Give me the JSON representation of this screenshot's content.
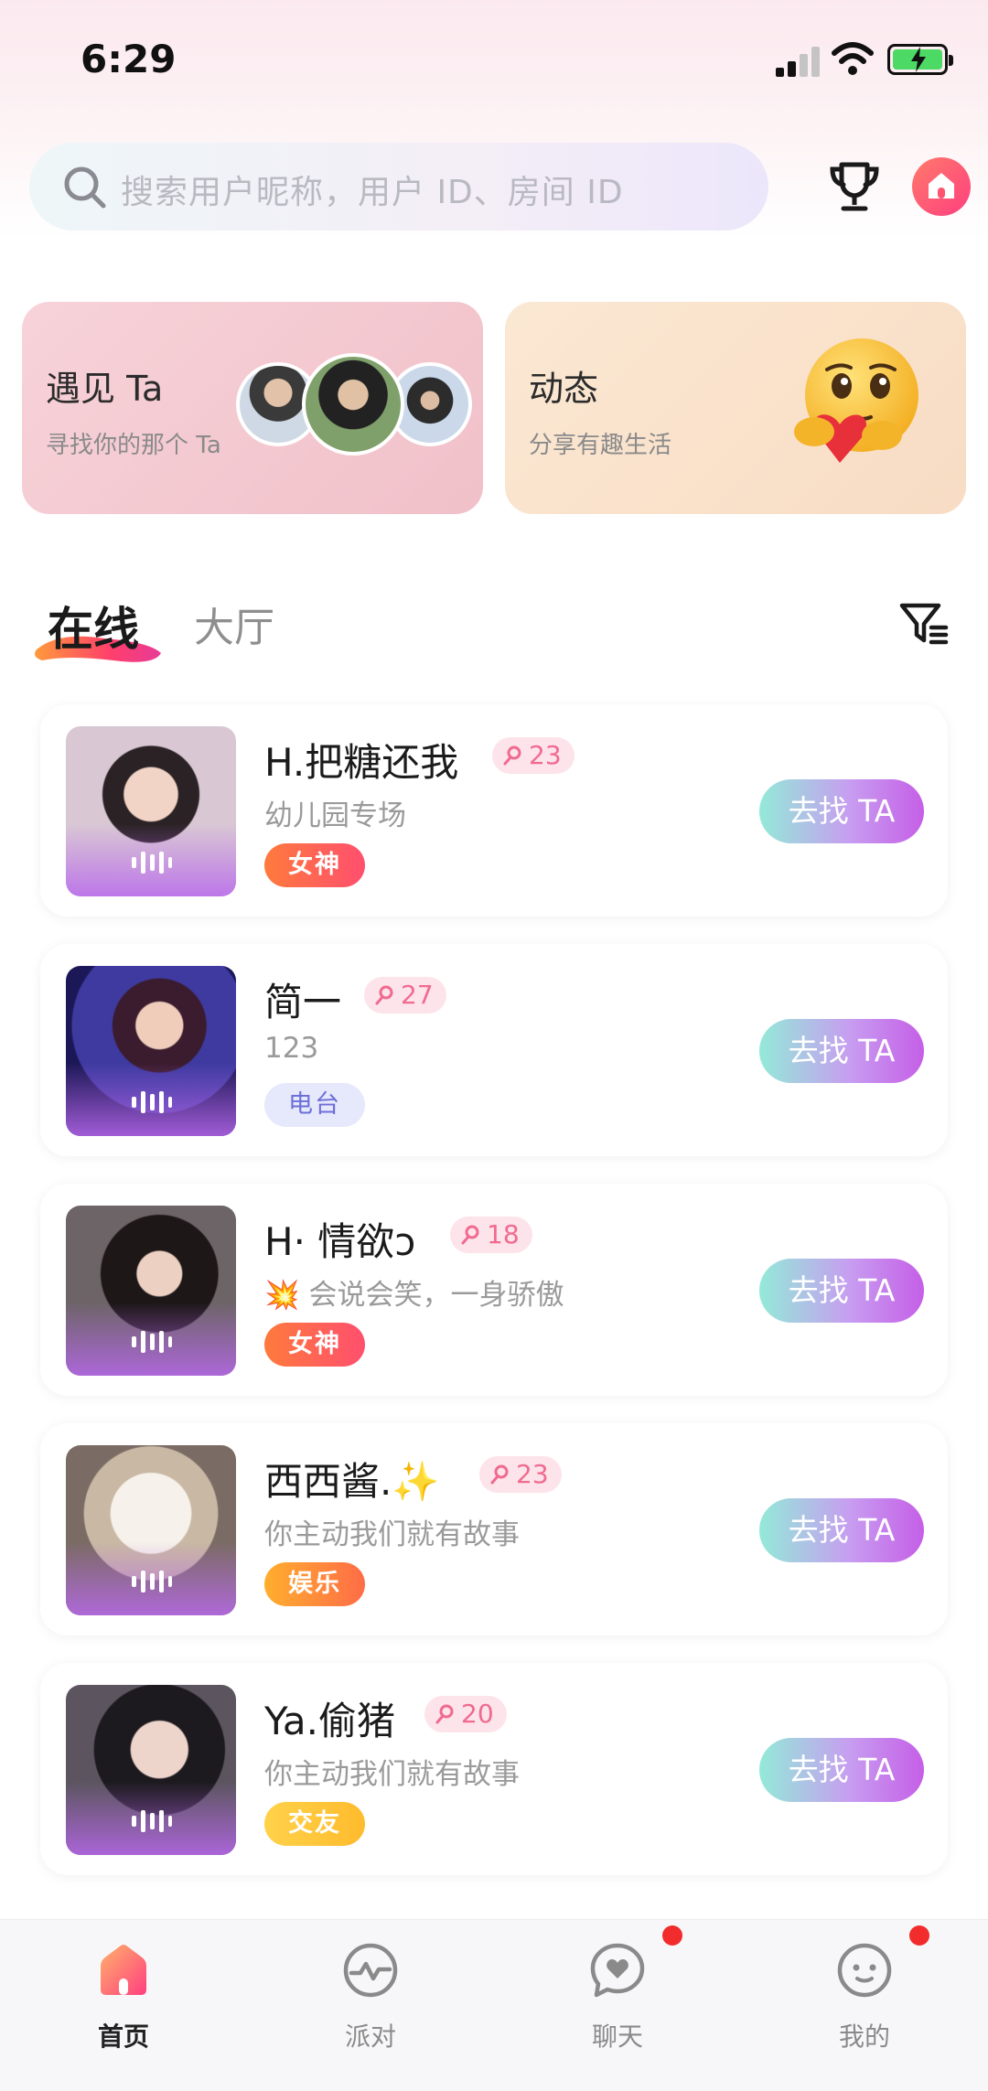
{
  "status_bar": {
    "time": "6:29"
  },
  "search": {
    "placeholder": "搜索用户昵称，用户 ID、房间 ID"
  },
  "feature_cards": {
    "meet": {
      "title": "遇见 Ta",
      "subtitle": "寻找你的那个 Ta"
    },
    "moment": {
      "title": "动态",
      "subtitle": "分享有趣生活"
    }
  },
  "tabs": {
    "online": "在线",
    "hall": "大厅"
  },
  "list": [
    {
      "name": "H.把糖还我",
      "level": "23",
      "signature": "幼儿园专场",
      "tag": "女神",
      "tag_style": "goddess",
      "button": "去找 TA"
    },
    {
      "name": "简一",
      "level": "27",
      "signature": "123",
      "tag": "电台",
      "tag_style": "radio",
      "button": "去找 TA"
    },
    {
      "name": "H· 情欲ↄ",
      "level": "18",
      "signature": "💥 会说会笑，一身骄傲",
      "tag": "女神",
      "tag_style": "goddess",
      "button": "去找 TA"
    },
    {
      "name": "西西酱.✨",
      "level": "23",
      "signature": "你主动我们就有故事",
      "tag": "娱乐",
      "tag_style": "fun",
      "button": "去找 TA"
    },
    {
      "name": "Ya.偷猪",
      "level": "20",
      "signature": "你主动我们就有故事",
      "tag": "交友",
      "tag_style": "friend",
      "button": "去找 TA"
    }
  ],
  "bottom_nav": {
    "home": "首页",
    "party": "派对",
    "chat": "聊天",
    "mine": "我的"
  },
  "colors": {
    "accent_pink": "#ff3f7f",
    "button_gradient_start": "#93ead8",
    "button_gradient_end": "#c55fe7",
    "notification_dot": "#f22c2c"
  },
  "icons": {
    "search": "search-icon",
    "trophy": "trophy-icon",
    "home_badge": "home-icon",
    "filter": "filter-icon",
    "voice": "sound-wave-icon"
  }
}
